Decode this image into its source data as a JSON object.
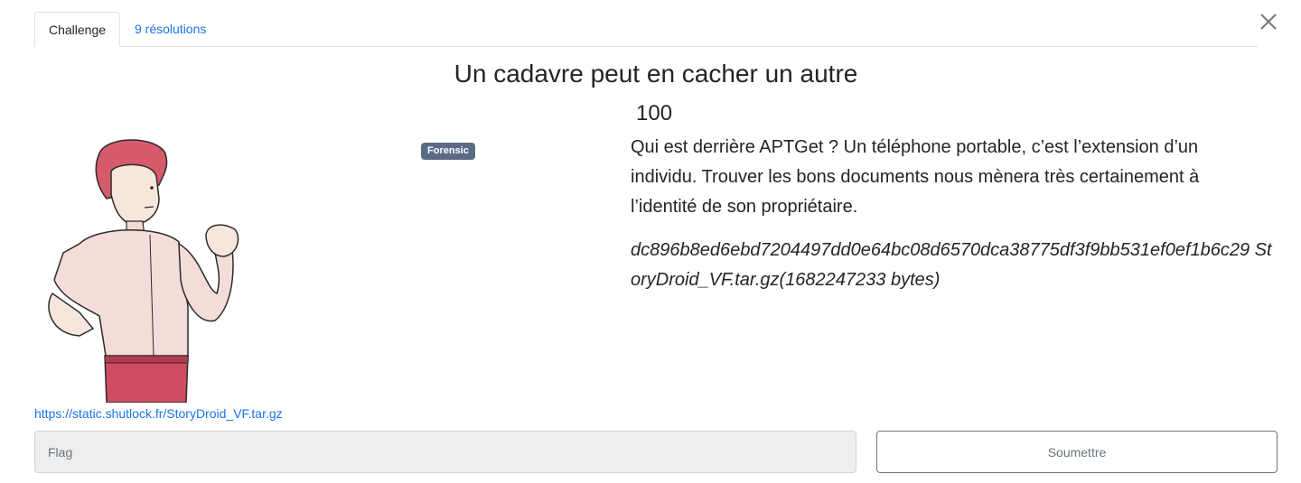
{
  "tabs": {
    "challenge_label": "Challenge",
    "solves_label": "9 résolutions"
  },
  "challenge": {
    "title": "Un cadavre peut en cacher un autre",
    "points": "100",
    "category_tag": "Forensic",
    "description": "Qui est derrière APTGet ? Un téléphone portable, c’est l’extension d’un individu. Trouver les bons documents nous mènera très certainement à l’identité de son propriétaire.",
    "file_hash_line": "dc896b8ed6ebd7204497dd0e64bc08d6570dca38775df3f9bb531ef0ef1b6c29 StoryDroid_VF.tar.gz(1682247233 bytes)",
    "file_link": "https://static.shutlock.fr/StoryDroid_VF.tar.gz"
  },
  "form": {
    "flag_placeholder": "Flag",
    "flag_value": "",
    "submit_label": "Soumettre"
  },
  "icons": {
    "close": "close-icon",
    "illustration": "character-illustration"
  },
  "colors": {
    "link": "#1a73e8",
    "tag_bg": "#5a6b85",
    "input_bg": "#eeeeee"
  }
}
